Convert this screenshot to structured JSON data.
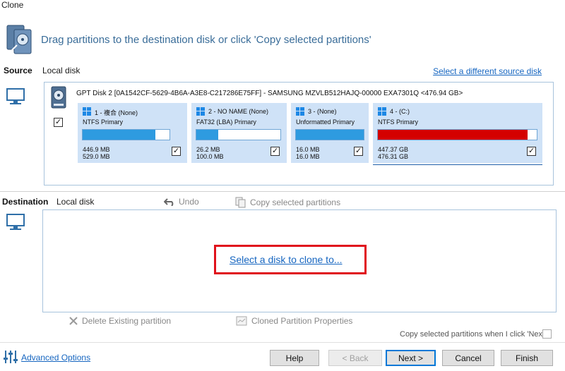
{
  "window": {
    "title": "Clone"
  },
  "header": {
    "instruction": "Drag partitions to the destination disk or click 'Copy selected partitions'"
  },
  "source": {
    "label": "Source",
    "sublabel": "Local disk",
    "select_link": "Select a different source disk",
    "disk_title": "GPT Disk 2 [0A1542CF-5629-4B6A-A3E8-C217286E75FF] - SAMSUNG MZVLB512HAJQ-00000 EXA7301Q  <476.94 GB>",
    "disk_checked": true,
    "partitions": [
      {
        "name": "1 - 複合 (None)",
        "type": "NTFS Primary",
        "used": "446.9 MB",
        "total": "529.0 MB",
        "fill_fraction": 0.84,
        "color": "#2e9be0",
        "checked": true
      },
      {
        "name": "2 - NO NAME (None)",
        "type": "FAT32 (LBA) Primary",
        "used": "26.2 MB",
        "total": "100.0 MB",
        "fill_fraction": 0.26,
        "color": "#2e9be0",
        "checked": true
      },
      {
        "name": "3 -  (None)",
        "type": "Unformatted Primary",
        "used": "16.0 MB",
        "total": "16.0 MB",
        "fill_fraction": 1.0,
        "color": "#2e9be0",
        "checked": true
      },
      {
        "name": "4 -  (C:)",
        "type": "NTFS Primary",
        "used": "447.37 GB",
        "total": "476.31 GB",
        "fill_fraction": 0.94,
        "color": "#d40000",
        "checked": true
      }
    ]
  },
  "destination": {
    "label": "Destination",
    "sublabel": "Local disk",
    "undo": "Undo",
    "copy_selected": "Copy selected partitions",
    "select_disk_link": "Select a disk to clone to...",
    "delete_partition": "Delete Existing partition",
    "cloned_props": "Cloned Partition Properties",
    "copy_on_next_label": "Copy selected partitions when I click 'Next'",
    "copy_on_next_checked": false
  },
  "footer": {
    "advanced_options": "Advanced Options",
    "help": "Help",
    "back": "< Back",
    "next": "Next >",
    "cancel": "Cancel",
    "finish": "Finish"
  },
  "colors": {
    "accent": "#1565c0",
    "highlight": "#e0121c",
    "partition_bg": "#cfe2f7",
    "bar_blue": "#2e9be0",
    "bar_red": "#d40000"
  }
}
